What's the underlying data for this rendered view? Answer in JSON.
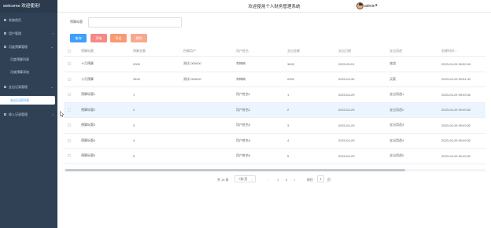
{
  "sidebar": {
    "welcome": "welcome 欢迎使用！",
    "items": [
      {
        "label": "系统首页",
        "chevron": ""
      },
      {
        "label": "用户管理",
        "chevron": "›"
      },
      {
        "label": "月度预算管理",
        "chevron": "⌄"
      },
      {
        "label": "月度预算列表",
        "chevron": ""
      },
      {
        "label": "月度预算添加",
        "chevron": ""
      },
      {
        "label": "支出记录管理",
        "chevron": "⌄"
      },
      {
        "label": "支出记录列表",
        "chevron": ""
      },
      {
        "label": "收入记录管理",
        "chevron": "›"
      }
    ]
  },
  "header": {
    "title": "欢迎使用个人财务管理系统",
    "user": "admin",
    "user_caret": "▾"
  },
  "search": {
    "label": "预算标题",
    "value": ""
  },
  "toolbar": {
    "search": "查询",
    "add": "添加",
    "export": "导出",
    "delete": "删除"
  },
  "table": {
    "columns": [
      "预算标题",
      "预算金额",
      "所属用户",
      "用户姓名",
      "支出金额",
      "支出日期",
      "支出用途",
      "创建时间 ↕"
    ],
    "rows": [
      [
        "十月预算",
        "2000",
        "测试-000000",
        "李梅梅",
        "3400",
        "2023-05-01",
        "旅游",
        "2023-04-29 09:52:00"
      ],
      [
        "十月预算",
        "3400",
        "测试-000000",
        "李梅梅",
        "2000",
        "2023-04-30",
        "买菜",
        "2023-04-29 09:51:42"
      ],
      [
        "预算标题1",
        "1",
        "",
        "用户姓名1",
        "1",
        "2023-04-29",
        "支出用途1",
        "2023-04-29 09:49:32"
      ],
      [
        "预算标题2",
        "2",
        "",
        "用户姓名2",
        "2",
        "2023-04-29",
        "支出用途2",
        "2023-04-29 09:49:32"
      ],
      [
        "预算标题3",
        "3",
        "",
        "用户姓名3",
        "3",
        "2023-04-29",
        "支出用途3",
        "2023-04-29 09:49:32"
      ],
      [
        "预算标题4",
        "4",
        "",
        "用户姓名4",
        "4",
        "2023-04-29",
        "支出用途4",
        "2023-04-29 09:49:32"
      ],
      [
        "预算标题5",
        "5",
        "",
        "用户姓名5",
        "5",
        "2023-04-29",
        "支出用途5",
        "2023-04-29 09:49:32"
      ]
    ],
    "highlighted_row": 3
  },
  "pagination": {
    "total": "共 14 条",
    "page_size": "7条/页",
    "prev": "‹",
    "pages": [
      "1",
      "2"
    ],
    "current": "2",
    "next": "›",
    "goto_label": "前往",
    "goto_value": "1",
    "page_unit": "页"
  },
  "colors": {
    "sidebar_bg": "#304156",
    "primary": "#409eff",
    "add": "#f78989",
    "export": "#f89a73",
    "delete": "#f8a88c",
    "highlight_row": "#ecf5ff"
  },
  "icons": [
    "house-icon",
    "users-icon",
    "wallet-icon",
    "receipt-icon",
    "income-icon",
    "mouse-cursor-icon"
  ]
}
